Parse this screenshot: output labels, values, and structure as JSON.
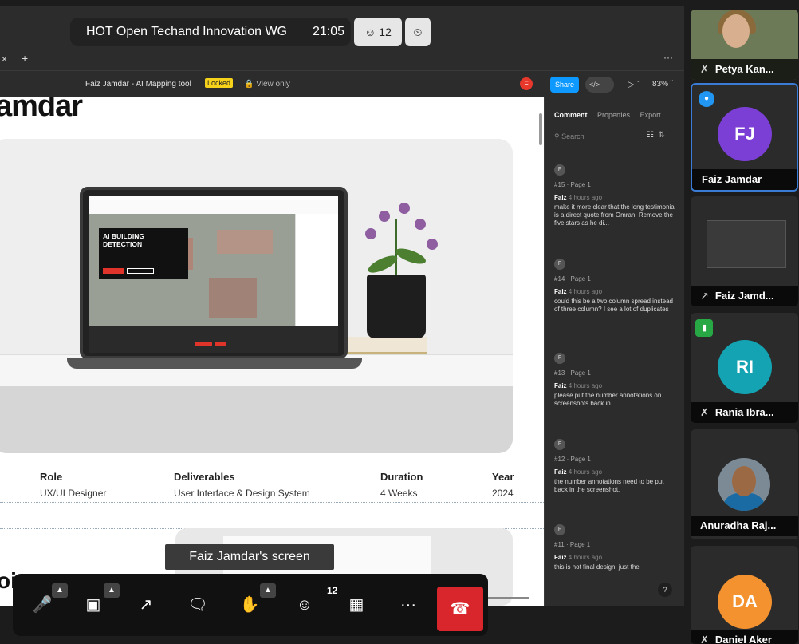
{
  "meeting": {
    "title": "HOT Open Techand Innovation WG",
    "time": "21:05",
    "participant_count": "12",
    "screen_caption": "Faiz Jamdar's screen"
  },
  "figma": {
    "file_title": "Faiz Jamdar - AI Mapping tool",
    "locked_label": "Locked",
    "view_only_label": "View only",
    "user_initial": "F",
    "share_label": "Share",
    "dev_label": "</>",
    "zoom": "83%",
    "tab_close": "×",
    "tab_add": "+",
    "more": "···"
  },
  "canvas": {
    "heading_partial": "amdar",
    "ai_heading": "AI BUILDING DETECTION",
    "meta": [
      {
        "key": "Role",
        "value": "UX/UI Designer"
      },
      {
        "key": "Deliverables",
        "value": "User Interface & Design System"
      },
      {
        "key": "Duration",
        "value": "4 Weeks"
      },
      {
        "key": "Year",
        "value": "2024"
      }
    ],
    "bottom_heading_partial": "oi"
  },
  "comments_panel": {
    "tabs": [
      "Comment",
      "Properties",
      "Export"
    ],
    "search_placeholder": "Search",
    "items": [
      {
        "initial": "F",
        "ref": "#15 · Page 1",
        "author": "Faiz",
        "time": "4 hours ago",
        "text": "make it more clear that the long testimonial is a direct quote from Omran. Remove the five stars as he di..."
      },
      {
        "initial": "F",
        "ref": "#14 · Page 1",
        "author": "Faiz",
        "time": "4 hours ago",
        "text": "could this be a two column spread instead of three column? I see a lot of duplicates"
      },
      {
        "initial": "F",
        "ref": "#13 · Page 1",
        "author": "Faiz",
        "time": "4 hours ago",
        "text": "please put the number annotations on screenshots back in"
      },
      {
        "initial": "F",
        "ref": "#12 · Page 1",
        "author": "Faiz",
        "time": "4 hours ago",
        "text": "the number annotations need to be put back in the screenshot."
      },
      {
        "initial": "F",
        "ref": "#11 · Page 1",
        "author": "Faiz",
        "time": "4 hours ago",
        "text": "this is not final design, just the"
      }
    ],
    "help": "?"
  },
  "participants": [
    {
      "name": "Petya Kan...",
      "initials": ""
    },
    {
      "name": "Faiz Jamdar",
      "initials": "FJ",
      "color": "#7b3fd6"
    },
    {
      "name": "Faiz Jamd...",
      "initials": ""
    },
    {
      "name": "Rania Ibra...",
      "initials": "RI",
      "color": "#14a3b3"
    },
    {
      "name": "Anuradha Raj...",
      "initials": ""
    },
    {
      "name": "Daniel Aker",
      "initials": "DA",
      "color": "#f4922f"
    }
  ],
  "toolbar": {
    "people_badge": "12"
  }
}
